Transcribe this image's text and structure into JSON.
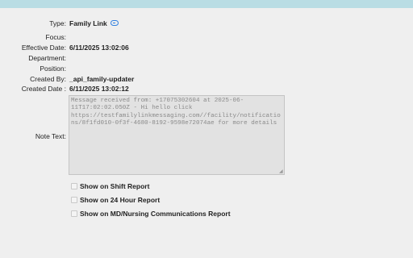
{
  "fields": [
    {
      "label": "Type:",
      "value": "Family Link",
      "has_icon": true
    },
    {
      "label": "Focus:",
      "value": ""
    },
    {
      "label": "Effective Date:",
      "value": "6/11/2025 13:02:06"
    },
    {
      "label": "Department:",
      "value": ""
    },
    {
      "label": "Position:",
      "value": ""
    },
    {
      "label": "Created By:",
      "value": "_api_family-updater"
    },
    {
      "label": "Created Date :",
      "value": "6/11/2025 13:02:12"
    }
  ],
  "icons": {
    "type_icon": "link-icon",
    "resize": "resize-grip-icon"
  },
  "note": {
    "label": "Note Text:",
    "value": "Message received from: +17075302604 at 2025-06-11T17:02:02.050Z - Hi hello click https://testfamilylinkmessaging.com//facility/notifications/8f1fd010-0f3f-4680-8192-9598e72074ae for more details"
  },
  "checkboxes": [
    {
      "label": "Show on Shift Report",
      "checked": false
    },
    {
      "label": "Show on 24 Hour Report",
      "checked": false
    },
    {
      "label": "Show on MD/Nursing Communications Report",
      "checked": false
    }
  ],
  "colors": {
    "topbar": "#b9dde4",
    "background": "#efefef",
    "icon": "#2f7fe0"
  }
}
